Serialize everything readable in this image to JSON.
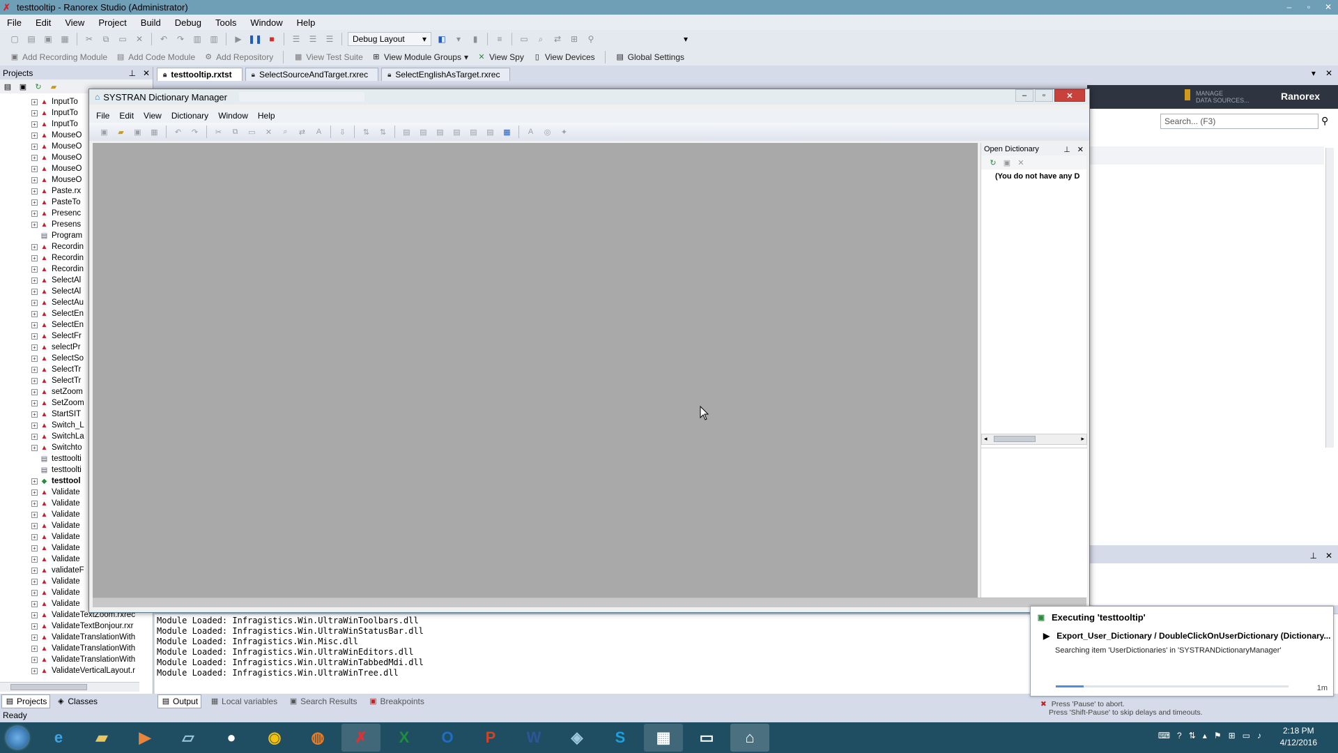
{
  "window": {
    "title": "testtooltip - Ranorex Studio (Administrator)",
    "controls": [
      "–",
      "▫",
      "✕"
    ]
  },
  "menu": [
    "File",
    "Edit",
    "View",
    "Project",
    "Build",
    "Debug",
    "Tools",
    "Window",
    "Help"
  ],
  "toolbar1": {
    "layout_combo": "Debug Layout"
  },
  "toolbar2": {
    "items": [
      "Add Recording Module",
      "Add Code Module",
      "Add Repository",
      "View Test Suite",
      "View Module Groups",
      "View Spy",
      "View Devices",
      "Global Settings"
    ]
  },
  "projects_panel": {
    "title": "Projects",
    "tree": [
      {
        "label": "InputTo",
        "icon": "rec"
      },
      {
        "label": "InputTo",
        "icon": "rec"
      },
      {
        "label": "InputTo",
        "icon": "rec"
      },
      {
        "label": "MouseO",
        "icon": "rec"
      },
      {
        "label": "MouseO",
        "icon": "rec"
      },
      {
        "label": "MouseO",
        "icon": "rec"
      },
      {
        "label": "MouseO",
        "icon": "rec"
      },
      {
        "label": "MouseO",
        "icon": "rec"
      },
      {
        "label": "Paste.rx",
        "icon": "rec"
      },
      {
        "label": "PasteTo",
        "icon": "rec"
      },
      {
        "label": "Presenc",
        "icon": "rec"
      },
      {
        "label": "Presens",
        "icon": "rec"
      },
      {
        "label": "Program",
        "icon": "doc",
        "leaf": true
      },
      {
        "label": "Recordin",
        "icon": "rec"
      },
      {
        "label": "Recordin",
        "icon": "rec"
      },
      {
        "label": "Recordin",
        "icon": "rec"
      },
      {
        "label": "SelectAl",
        "icon": "rec"
      },
      {
        "label": "SelectAl",
        "icon": "rec"
      },
      {
        "label": "SelectAu",
        "icon": "rec"
      },
      {
        "label": "SelectEn",
        "icon": "rec"
      },
      {
        "label": "SelectEn",
        "icon": "rec"
      },
      {
        "label": "SelectFr",
        "icon": "rec"
      },
      {
        "label": "selectPr",
        "icon": "rec"
      },
      {
        "label": "SelectSo",
        "icon": "rec"
      },
      {
        "label": "SelectTr",
        "icon": "rec"
      },
      {
        "label": "SelectTr",
        "icon": "rec"
      },
      {
        "label": "setZoom",
        "icon": "rec"
      },
      {
        "label": "SetZoom",
        "icon": "rec"
      },
      {
        "label": "StartSIT",
        "icon": "rec"
      },
      {
        "label": "Switch_L",
        "icon": "rec"
      },
      {
        "label": "SwitchLa",
        "icon": "rec"
      },
      {
        "label": "Switchto",
        "icon": "rec"
      },
      {
        "label": "testtoolti",
        "icon": "doc",
        "leaf": true
      },
      {
        "label": "testtoolti",
        "icon": "doc",
        "leaf": true
      },
      {
        "label": "testtool",
        "icon": "grn",
        "bold": true
      },
      {
        "label": "Validate",
        "icon": "rec"
      },
      {
        "label": "Validate",
        "icon": "rec"
      },
      {
        "label": "Validate",
        "icon": "rec"
      },
      {
        "label": "Validate",
        "icon": "rec"
      },
      {
        "label": "Validate",
        "icon": "rec"
      },
      {
        "label": "Validate",
        "icon": "rec"
      },
      {
        "label": "Validate",
        "icon": "rec"
      },
      {
        "label": "validateF",
        "icon": "rec"
      },
      {
        "label": "Validate",
        "icon": "rec"
      },
      {
        "label": "Validate",
        "icon": "rec"
      },
      {
        "label": "Validate",
        "icon": "rec"
      },
      {
        "label": "ValidateTextZoom.rxrec",
        "icon": "rec"
      },
      {
        "label": "ValidateTextBonjour.rxr",
        "icon": "rec"
      },
      {
        "label": "ValidateTranslationWith",
        "icon": "rec"
      },
      {
        "label": "ValidateTranslationWith",
        "icon": "rec"
      },
      {
        "label": "ValidateTranslationWith",
        "icon": "rec"
      },
      {
        "label": "ValidateVerticalLayout.r",
        "icon": "rec"
      }
    ],
    "tabs": [
      "Projects",
      "Classes"
    ]
  },
  "doc_tabs": [
    "testtooltip.rxtst",
    "SelectSourceAndTarget.rxrec",
    "SelectEnglishAsTarget.rxrec"
  ],
  "right_panel": {
    "search_placeholder": "Search... (F3)",
    "manage_label": "MANAGE\nDATA SOURCES...",
    "brand": "Ranorex"
  },
  "systran": {
    "title": "SYSTRAN Dictionary Manager",
    "menu": [
      "File",
      "Edit",
      "View",
      "Dictionary",
      "Window",
      "Help"
    ],
    "open_dictionary_title": "Open Dictionary",
    "open_dictionary_message": "(You do not have any D"
  },
  "output": {
    "lines": [
      "Module Loaded: Infragistics.Win.UltraWinToolbars.dll",
      "Module Loaded: Infragistics.Win.UltraWinStatusBar.dll",
      "Module Loaded: Infragistics.Win.Misc.dll",
      "Module Loaded: Infragistics.Win.UltraWinEditors.dll",
      "Module Loaded: Infragistics.Win.UltraWinTabbedMdi.dll",
      "Module Loaded: Infragistics.Win.UltraWinTree.dll"
    ],
    "tabs": [
      "Output",
      "Local variables",
      "Search Results",
      "Breakpoints"
    ]
  },
  "status": "Ready",
  "notification": {
    "title": "Executing 'testtooltip'",
    "step": "Export_User_Dictionary / DoubleClickOnUserDictionary (Dictionary...",
    "desc": "Searching item 'UserDictionaries' in 'SYSTRANDictionaryManager'",
    "progress": 0.12,
    "time": "1m",
    "hint1": "Press 'Pause' to abort.",
    "hint2": "Press 'Shift-Pause' to skip delays and timeouts."
  },
  "taskbar": {
    "time": "2:18 PM",
    "date": "4/12/2016"
  },
  "colors": {
    "titlebar": "#6f9fb7",
    "taskbar": "#1f4e62",
    "workspace": "#a9a9a9",
    "close_button": "#c8423b"
  }
}
